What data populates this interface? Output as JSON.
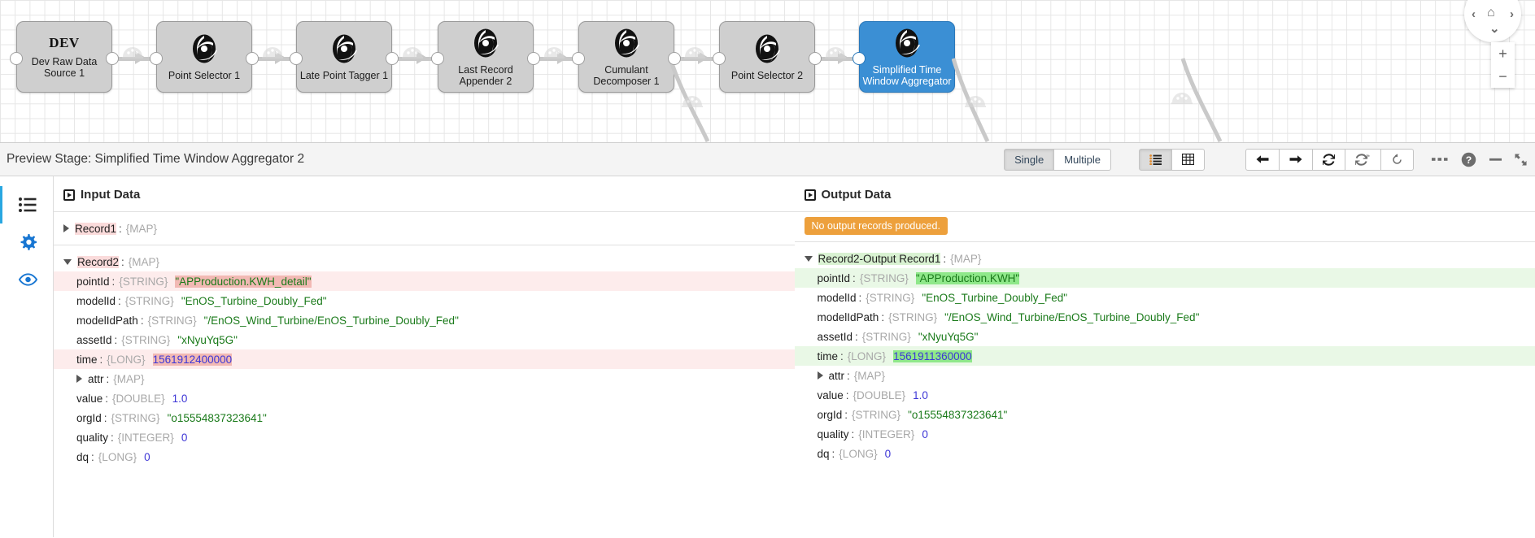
{
  "canvas": {
    "nodes": [
      {
        "id": "dev-raw-data-source-1",
        "label": "Dev Raw Data\nSource 1",
        "icon": "dev-text",
        "badge": "DEV",
        "selected": false
      },
      {
        "id": "point-selector-1",
        "label": "Point Selector 1",
        "icon": "enos-logo",
        "selected": false
      },
      {
        "id": "late-point-tagger-1",
        "label": "Late Point Tagger 1",
        "icon": "enos-logo",
        "selected": false
      },
      {
        "id": "last-record-appender-2",
        "label": "Last Record\nAppender 2",
        "icon": "enos-logo",
        "selected": false
      },
      {
        "id": "cumulant-decomposer-1",
        "label": "Cumulant\nDecomposer 1",
        "icon": "enos-logo",
        "selected": false
      },
      {
        "id": "point-selector-2",
        "label": "Point Selector 2",
        "icon": "enos-logo",
        "selected": false
      },
      {
        "id": "simplified-time-window-aggregator",
        "label": "Simplified Time\nWindow Aggregator",
        "icon": "enos-logo",
        "selected": true
      }
    ],
    "controls": {
      "pan_up": "⌃",
      "pan_left": "‹",
      "pan_home": "⌂",
      "pan_right": "›",
      "pan_down": "⌄",
      "zoom_in": "+",
      "zoom_out": "−"
    }
  },
  "toolbar": {
    "title": "Preview Stage: Simplified Time Window Aggregator 2",
    "mode_single": "Single",
    "mode_multiple": "Multiple",
    "mode_active": "Single",
    "view_list": "☰",
    "view_table": "▦",
    "view_active": "list",
    "nav_back": "←",
    "nav_forward": "→",
    "nav_refresh": "↻",
    "nav_refresh_all": "↻",
    "nav_revert": "↺",
    "more": "•••",
    "help": "?",
    "minimize": "—",
    "expand": "⤢"
  },
  "sidebar": {
    "items": [
      {
        "name": "list-view",
        "icon": "list-icon",
        "active": true
      },
      {
        "name": "settings",
        "icon": "gear-icon",
        "active": false
      },
      {
        "name": "preview",
        "icon": "eye-icon",
        "active": false
      }
    ]
  },
  "input_pane": {
    "title": "Input Data",
    "records": [
      {
        "name": "Record1",
        "type": "{MAP}",
        "expanded": false,
        "highlight": "in"
      },
      {
        "name": "Record2",
        "type": "{MAP}",
        "expanded": true,
        "highlight": "in"
      }
    ],
    "fields": [
      {
        "key": "pointId",
        "type": "{STRING}",
        "value": "\"APProduction.KWH_detail\"",
        "value_kind": "str",
        "row_highlight": true,
        "value_highlight": true
      },
      {
        "key": "modelId",
        "type": "{STRING}",
        "value": "\"EnOS_Turbine_Doubly_Fed\"",
        "value_kind": "str",
        "row_highlight": false,
        "value_highlight": false
      },
      {
        "key": "modelIdPath",
        "type": "{STRING}",
        "value": "\"/EnOS_Wind_Turbine/EnOS_Turbine_Doubly_Fed\"",
        "value_kind": "str",
        "row_highlight": false,
        "value_highlight": false
      },
      {
        "key": "assetId",
        "type": "{STRING}",
        "value": "\"xNyuYq5G\"",
        "value_kind": "str",
        "row_highlight": false,
        "value_highlight": false
      },
      {
        "key": "time",
        "type": "{LONG}",
        "value": "1561912400000",
        "value_kind": "num",
        "row_highlight": true,
        "value_highlight": true
      },
      {
        "key": "attr",
        "type": "{MAP}",
        "value": "",
        "value_kind": "none",
        "row_highlight": false,
        "value_highlight": false,
        "caret": "right"
      },
      {
        "key": "value",
        "type": "{DOUBLE}",
        "value": "1.0",
        "value_kind": "num",
        "row_highlight": false,
        "value_highlight": false
      },
      {
        "key": "orgId",
        "type": "{STRING}",
        "value": "\"o15554837323641\"",
        "value_kind": "str",
        "row_highlight": false,
        "value_highlight": false
      },
      {
        "key": "quality",
        "type": "{INTEGER}",
        "value": "0",
        "value_kind": "num",
        "row_highlight": false,
        "value_highlight": false
      },
      {
        "key": "dq",
        "type": "{LONG}",
        "value": "0",
        "value_kind": "num",
        "row_highlight": false,
        "value_highlight": false
      }
    ]
  },
  "output_pane": {
    "title": "Output Data",
    "notice": "No output records produced.",
    "records": [
      {
        "name": "Record2-Output Record1",
        "type": "{MAP}",
        "expanded": true,
        "highlight": "out"
      }
    ],
    "fields": [
      {
        "key": "pointId",
        "type": "{STRING}",
        "value": "\"APProduction.KWH\"",
        "value_kind": "str",
        "row_highlight": true,
        "value_highlight": true
      },
      {
        "key": "modelId",
        "type": "{STRING}",
        "value": "\"EnOS_Turbine_Doubly_Fed\"",
        "value_kind": "str",
        "row_highlight": false,
        "value_highlight": false
      },
      {
        "key": "modelIdPath",
        "type": "{STRING}",
        "value": "\"/EnOS_Wind_Turbine/EnOS_Turbine_Doubly_Fed\"",
        "value_kind": "str",
        "row_highlight": false,
        "value_highlight": false
      },
      {
        "key": "assetId",
        "type": "{STRING}",
        "value": "\"xNyuYq5G\"",
        "value_kind": "str",
        "row_highlight": false,
        "value_highlight": false
      },
      {
        "key": "time",
        "type": "{LONG}",
        "value": "1561911360000",
        "value_kind": "num",
        "row_highlight": true,
        "value_highlight": true
      },
      {
        "key": "attr",
        "type": "{MAP}",
        "value": "",
        "value_kind": "none",
        "row_highlight": false,
        "value_highlight": false,
        "caret": "right"
      },
      {
        "key": "value",
        "type": "{DOUBLE}",
        "value": "1.0",
        "value_kind": "num",
        "row_highlight": false,
        "value_highlight": false
      },
      {
        "key": "orgId",
        "type": "{STRING}",
        "value": "\"o15554837323641\"",
        "value_kind": "str",
        "row_highlight": false,
        "value_highlight": false
      },
      {
        "key": "quality",
        "type": "{INTEGER}",
        "value": "0",
        "value_kind": "num",
        "row_highlight": false,
        "value_highlight": false
      },
      {
        "key": "dq",
        "type": "{LONG}",
        "value": "0",
        "value_kind": "num",
        "row_highlight": false,
        "value_highlight": false
      }
    ]
  },
  "colors": {
    "selected_node": "#3b8fd4",
    "accent": "#29a7e1",
    "string_value": "#1a7a1a",
    "number_value": "#3d36d6",
    "warning_badge": "#eda03c",
    "input_highlight": "#fdecec",
    "output_highlight": "#e9f8e6"
  }
}
